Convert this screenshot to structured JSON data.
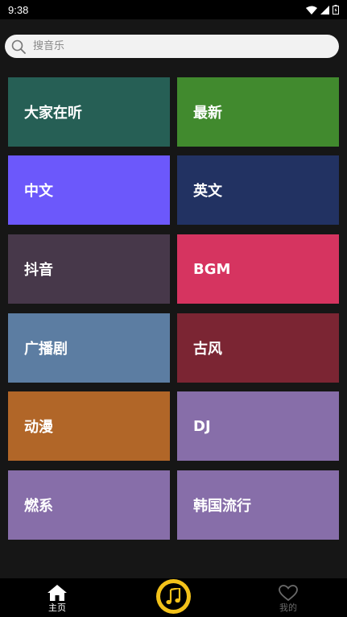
{
  "status_bar": {
    "time": "9:38"
  },
  "search": {
    "placeholder": "搜音乐"
  },
  "categories": [
    {
      "label": "大家在听",
      "color": "#265f55"
    },
    {
      "label": "最新",
      "color": "#418a2e"
    },
    {
      "label": "中文",
      "color": "#6c58fb"
    },
    {
      "label": "英文",
      "color": "#223262"
    },
    {
      "label": "抖音",
      "color": "#47384a"
    },
    {
      "label": "BGM",
      "color": "#d63460"
    },
    {
      "label": "广播剧",
      "color": "#5c7da2"
    },
    {
      "label": "古风",
      "color": "#7b2533"
    },
    {
      "label": "动漫",
      "color": "#b16628"
    },
    {
      "label": "DJ",
      "color": "#876ea9"
    },
    {
      "label": "燃系",
      "color": "#876ea9"
    },
    {
      "label": "韩国流行",
      "color": "#876ea9"
    }
  ],
  "bottom_nav": {
    "home_label": "主页",
    "mine_label": "我的",
    "home_icon": "home-icon",
    "player_icon": "music-note-icon",
    "mine_icon": "heart-icon"
  },
  "colors": {
    "background": "#161616",
    "accent": "#f3c21a"
  }
}
